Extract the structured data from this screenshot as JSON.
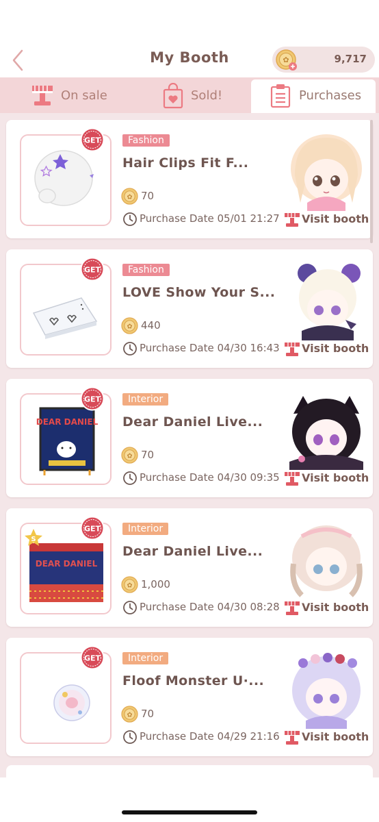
{
  "header": {
    "title": "My Booth",
    "coins": "9,717",
    "back_icon": "chevron-left-icon",
    "coin_icon": "coin-plus-icon"
  },
  "tabs": [
    {
      "label": "On sale",
      "icon": "stall-icon",
      "active": false
    },
    {
      "label": "Sold!",
      "icon": "shopping-bag-heart-icon",
      "active": false
    },
    {
      "label": "Purchases",
      "icon": "clipboard-list-icon",
      "active": true
    }
  ],
  "purchases": [
    {
      "category": "Fashion",
      "name": "Hair Clips Fit F...",
      "price": "70",
      "date": "Purchase Date 05/01 21:27",
      "visit": "Visit booth",
      "badge": "GET"
    },
    {
      "category": "Fashion",
      "name": "LOVE Show Your S...",
      "price": "440",
      "date": "Purchase Date 04/30 16:43",
      "visit": "Visit booth",
      "badge": "GET"
    },
    {
      "category": "Interior",
      "name": "Dear Daniel Live...",
      "price": "70",
      "date": "Purchase Date 04/30 09:35",
      "visit": "Visit booth",
      "badge": "GET",
      "thumb_text": "DEAR DANIEL"
    },
    {
      "category": "Interior",
      "name": "Dear Daniel Live...",
      "price": "1,000",
      "date": "Purchase Date 04/30 08:28",
      "visit": "Visit booth",
      "badge": "GET",
      "thumb_text": "DEAR DANIEL",
      "star_badge": "S"
    },
    {
      "category": "Interior",
      "name": "Floof Monster U·...",
      "price": "70",
      "date": "Purchase Date 04/29 21:16",
      "visit": "Visit booth",
      "badge": "GET"
    }
  ],
  "colors": {
    "tab_bar": "#f3d6d8",
    "list_bg": "#f4e6e8",
    "fashion_tag": "#ec8a93",
    "interior_tag": "#f2ab80",
    "text_brown": "#7a5c55"
  }
}
